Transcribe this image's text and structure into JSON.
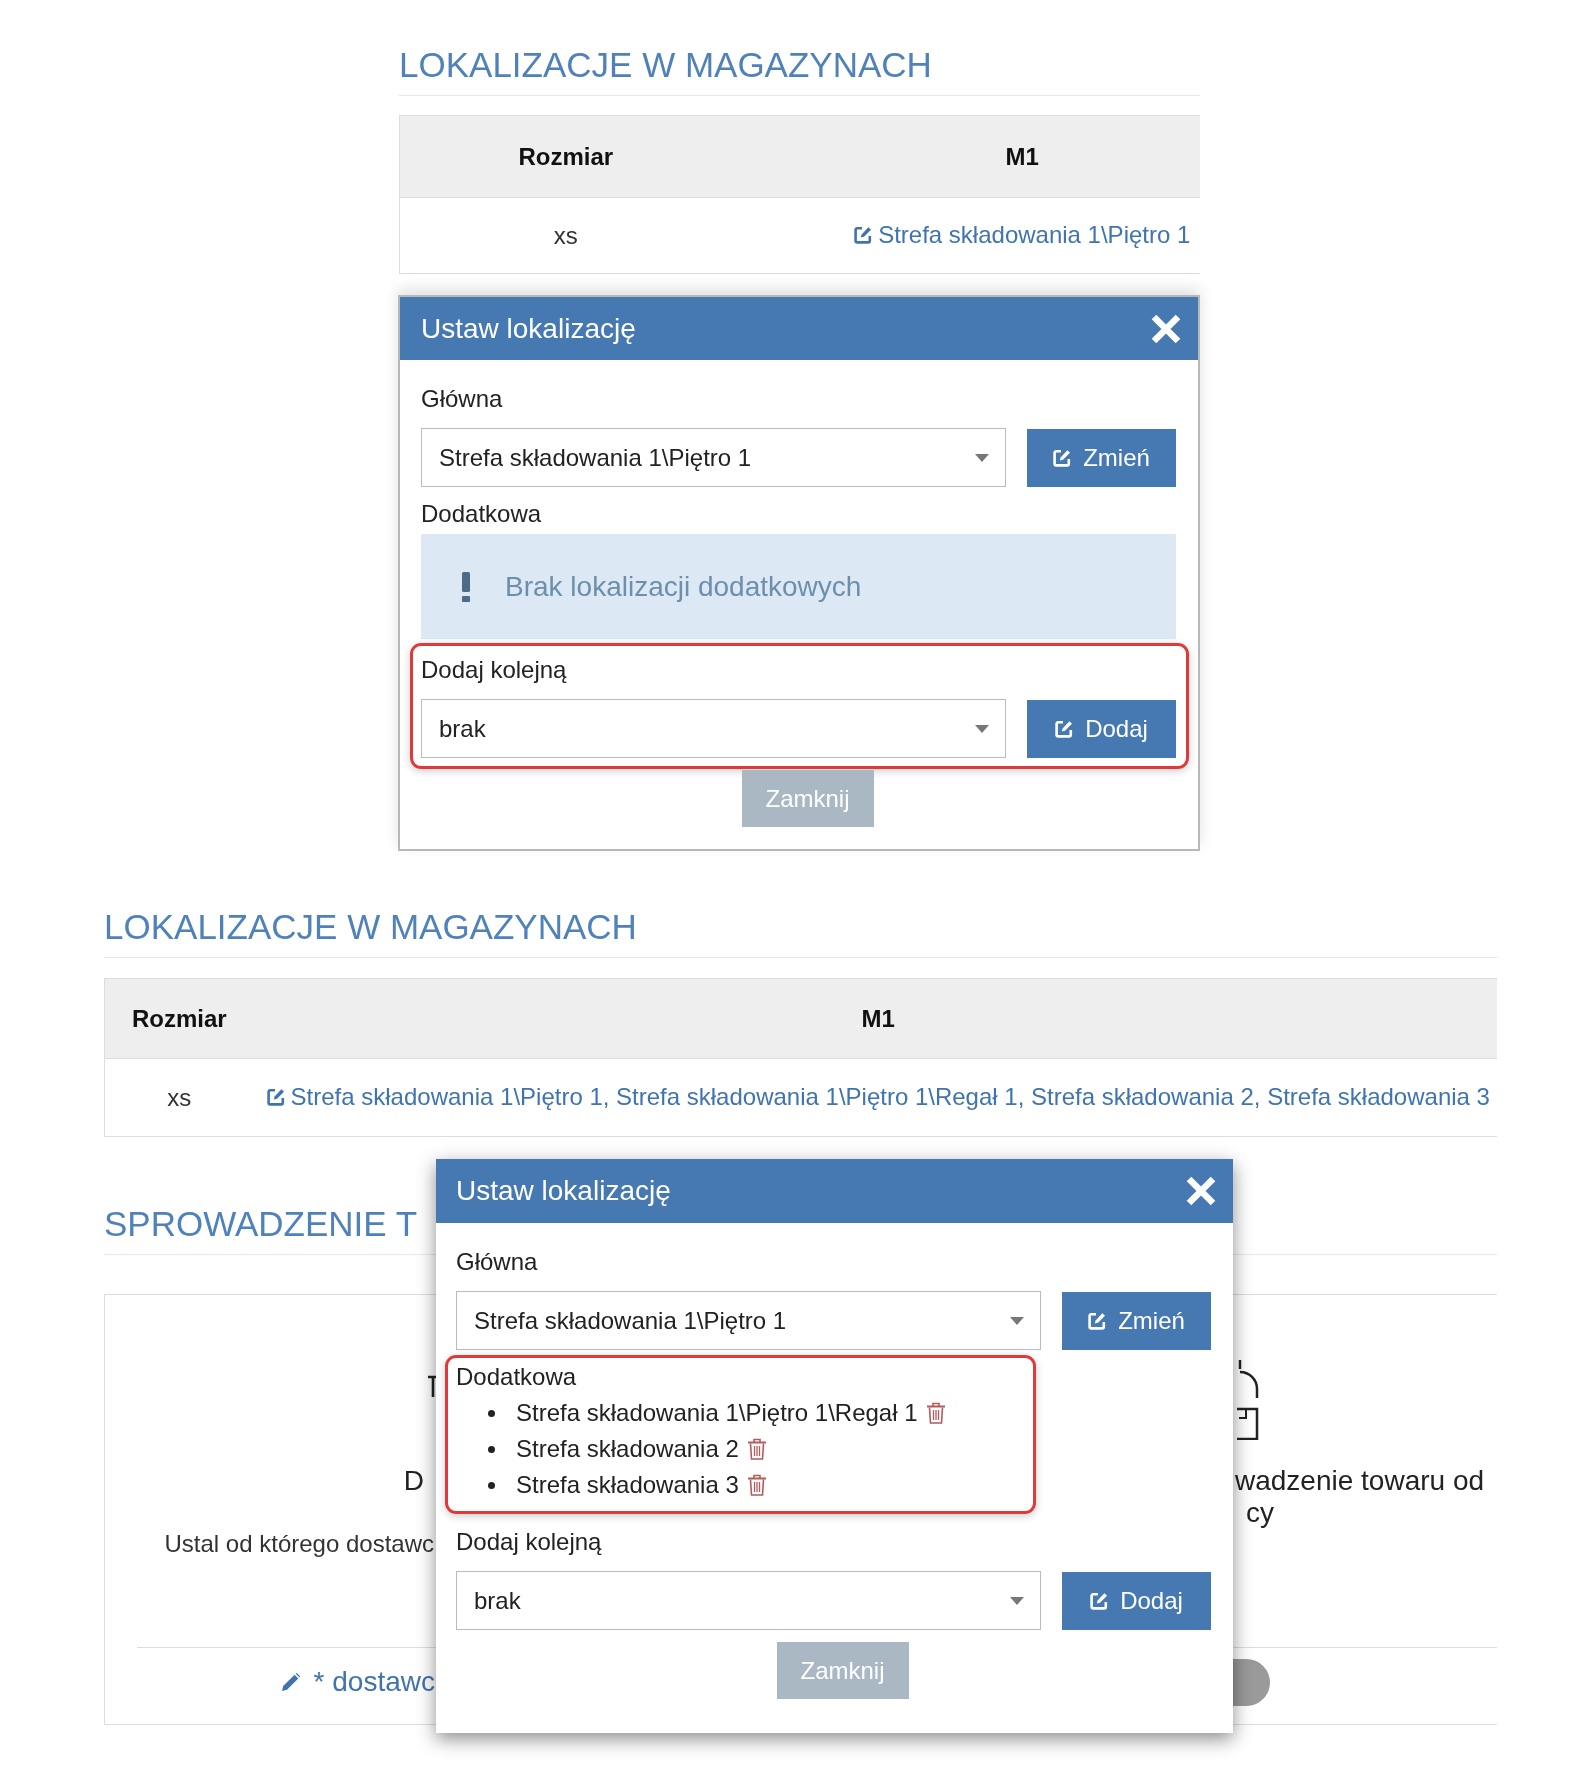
{
  "top_view": {
    "heading": "LOKALIZACJE W MAGAZYNACH",
    "table": {
      "columns": [
        "Rozmiar",
        "M1"
      ],
      "rows": [
        {
          "size": "xs",
          "locations": "Strefa składowania 1\\Piętro 1"
        }
      ]
    },
    "dialog": {
      "title": "Ustaw lokalizację",
      "main": {
        "label": "Główna",
        "value": "Strefa składowania 1\\Piętro 1",
        "button": "Zmień"
      },
      "additional": {
        "label": "Dodatkowa",
        "empty_message": "Brak lokalizacji dodatkowych",
        "highlighted": false
      },
      "add_next": {
        "label": "Dodaj kolejną",
        "value": "brak",
        "button": "Dodaj",
        "highlighted": true
      },
      "close_button": "Zamknij"
    }
  },
  "bottom_view": {
    "heading": "LOKALIZACJE W MAGAZYNACH",
    "table": {
      "columns": [
        "Rozmiar",
        "M1"
      ],
      "rows": [
        {
          "size": "xs",
          "locations": "Strefa składowania 1\\Piętro 1, Strefa składowania 1\\Piętro 1\\Regał 1, Strefa składowania 2, Strefa składowania 3"
        }
      ]
    },
    "section_heading": "SPROWADZENIE T",
    "panel": {
      "left_card": {
        "title": "D",
        "description": "Ustal od którego dostawc"
      },
      "right_card": {
        "title_lines": [
          "wadzenie towaru od",
          "cy"
        ]
      },
      "footer_link": "* dostawc",
      "toggle": {
        "on": false
      }
    },
    "dialog": {
      "title": "Ustaw lokalizację",
      "main": {
        "label": "Główna",
        "value": "Strefa składowania 1\\Piętro 1",
        "button": "Zmień"
      },
      "additional": {
        "label": "Dodatkowa",
        "items": [
          "Strefa składowania 1\\Piętro 1\\Regał 1",
          "Strefa składowania 2",
          "Strefa składowania 3"
        ],
        "highlighted": true
      },
      "add_next": {
        "label": "Dodaj kolejną",
        "value": "brak",
        "button": "Dodaj",
        "highlighted": false
      },
      "close_button": "Zamknij"
    }
  }
}
